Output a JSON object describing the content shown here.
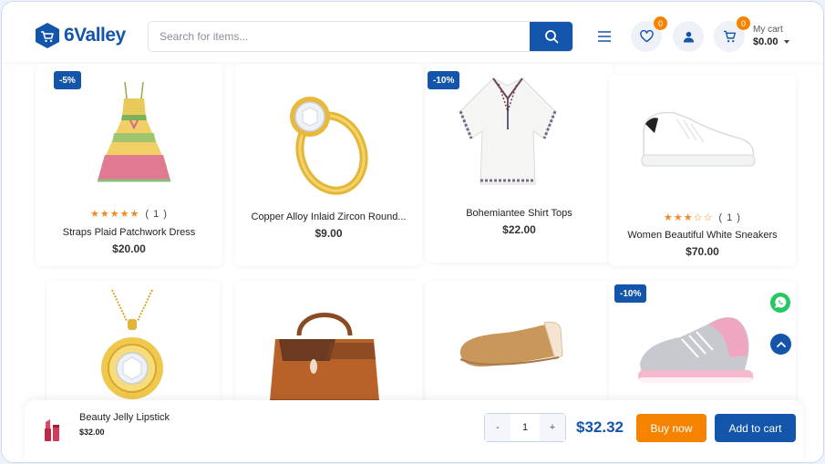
{
  "brand": {
    "name": "6Valley",
    "color": "#1455ac"
  },
  "search": {
    "placeholder": "Search for items..."
  },
  "header": {
    "wishlist_count": "0",
    "cart_count": "0",
    "cart_label": "My cart",
    "cart_total": "$0.00"
  },
  "products": [
    {
      "name": "Straps Plaid Patchwork Dress",
      "price": "$20.00",
      "discount": "-5%",
      "stars": "★★★★★",
      "reviews": "( 1 )"
    },
    {
      "name": "Copper Alloy Inlaid Zircon Round...",
      "price": "$9.00"
    },
    {
      "name": "Bohemiantee Shirt Tops",
      "price": "$22.00",
      "discount": "-10%"
    },
    {
      "name": "Women Beautiful White Sneakers",
      "price": "$70.00",
      "stars": "★★★☆☆",
      "reviews": "( 1 )"
    },
    {
      "icon": "necklace-icon"
    },
    {
      "icon": "handbag-icon"
    },
    {
      "icon": "flat-shoe-icon"
    },
    {
      "discount": "-10%",
      "icon": "pink-sneaker-icon"
    }
  ],
  "bottom_bar": {
    "product_name": "Beauty Jelly Lipstick",
    "product_price": "$32.00",
    "qty_minus": "-",
    "qty_value": "1",
    "qty_plus": "+",
    "total": "$32.32",
    "buy_now": "Buy now",
    "add_to_cart": "Add to cart"
  },
  "colors": {
    "primary": "#1455ac",
    "accent": "#f58300",
    "star": "#f08a24"
  }
}
